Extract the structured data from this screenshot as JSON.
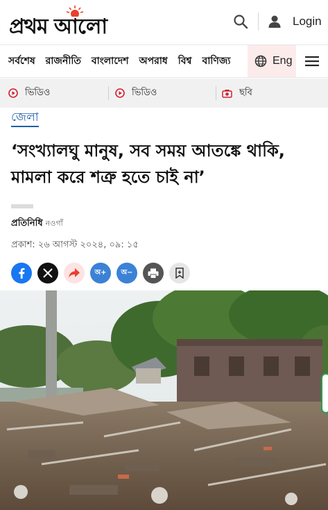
{
  "header": {
    "logo_text": "প্রথম আলো",
    "login_label": "Login"
  },
  "nav": {
    "items": [
      "সর্বশেষ",
      "রাজনীতি",
      "বাংলাদেশ",
      "অপরাধ",
      "বিশ্ব",
      "বাণিজ্য"
    ],
    "lang_label": "Eng"
  },
  "media": {
    "items": [
      {
        "label": "ভিডিও",
        "icon": "play-circle-icon"
      },
      {
        "label": "ভিডিও",
        "icon": "play-circle-icon"
      },
      {
        "label": "ছবি",
        "icon": "camera-icon"
      }
    ]
  },
  "article": {
    "section": "জেলা",
    "headline": "‘সংখ্যালঘু মানুষ, সব সময় আতঙ্কে থাকি, মামলা করে শত্রু হতে চাই না’",
    "author": "প্রতিনিধি",
    "location": "নওগাঁ",
    "published": "প্রকাশ: ২৬ আগস্ট ২০২৪, ০৯: ১৫"
  },
  "share": {
    "buttons": [
      {
        "name": "facebook-share-button",
        "icon": "facebook-icon",
        "color": "#1877f2"
      },
      {
        "name": "x-share-button",
        "icon": "x-icon",
        "color": "#111111"
      },
      {
        "name": "share-button",
        "icon": "share-arrow-icon",
        "color": "#fde3e3"
      },
      {
        "name": "font-increase-button",
        "label": "অ+",
        "color": "#3b82d6"
      },
      {
        "name": "font-decrease-button",
        "label": "অ−",
        "color": "#3b82d6"
      },
      {
        "name": "print-button",
        "icon": "printer-icon",
        "color": "#555555"
      },
      {
        "name": "bookmark-button",
        "icon": "bookmark-icon",
        "color": "#e6e6e6"
      }
    ]
  },
  "colors": {
    "brand_accent": "#e8412c",
    "link_blue": "#1f5ea8",
    "lang_bg": "#fcebeb",
    "media_bg": "#f1f1f1"
  }
}
